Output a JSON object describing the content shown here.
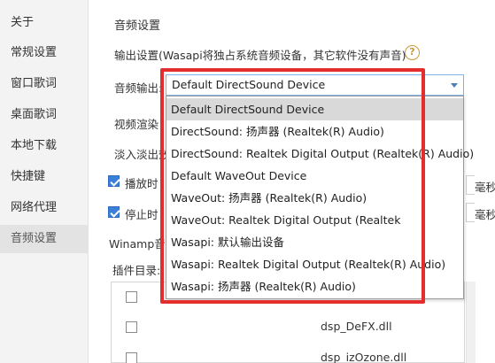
{
  "sidebar": {
    "items": [
      {
        "label": "关于"
      },
      {
        "label": "常规设置"
      },
      {
        "label": "窗口歌词"
      },
      {
        "label": "桌面歌词"
      },
      {
        "label": "本地下载"
      },
      {
        "label": "快捷键"
      },
      {
        "label": "网络代理"
      },
      {
        "label": "音频设置"
      }
    ],
    "active_index": 7
  },
  "main": {
    "section_title": "音频设置",
    "output_desc": "输出设置(Wasapi将独占系统音频设备，其它软件没有声音)",
    "help_icon": "?",
    "audio_output_label": "音频输出:",
    "audio_output_value": "Default DirectSound Device",
    "video_render_label": "视频渲染",
    "fade_label": "淡入淡出效",
    "play_label": "播放时",
    "play_checked": true,
    "stop_label": "停止时",
    "stop_checked": true,
    "seconds_unit_1": "毫秒",
    "seconds_unit_2": "毫秒",
    "winamp_label": "Winamp音",
    "plugin_dir_label": "插件目录:",
    "plugin_rows": [
      {
        "name": ""
      },
      {
        "name": "dsp_DeFX.dll"
      },
      {
        "name": "dsp_izOzone.dll"
      }
    ]
  },
  "dropdown": {
    "options": [
      {
        "label": "Default DirectSound Device"
      },
      {
        "label": "DirectSound: 扬声器 (Realtek(R) Audio)"
      },
      {
        "label": "DirectSound: Realtek Digital Output (Realtek(R) Audio)"
      },
      {
        "label": "Default WaveOut Device"
      },
      {
        "label": "WaveOut: 扬声器 (Realtek(R) Audio)"
      },
      {
        "label": "WaveOut: Realtek Digital Output (Realtek"
      },
      {
        "label": "Wasapi: 默认输出设备"
      },
      {
        "label": "Wasapi: Realtek Digital Output (Realtek(R) Audio)"
      },
      {
        "label": "Wasapi: 扬声器 (Realtek(R) Audio)"
      }
    ],
    "selected_index": 0
  },
  "colors": {
    "highlight": "#e42e2e",
    "select_border": "#7eb4ea",
    "checkbox": "#3c7fd6",
    "help_icon": "#c79a3a"
  }
}
